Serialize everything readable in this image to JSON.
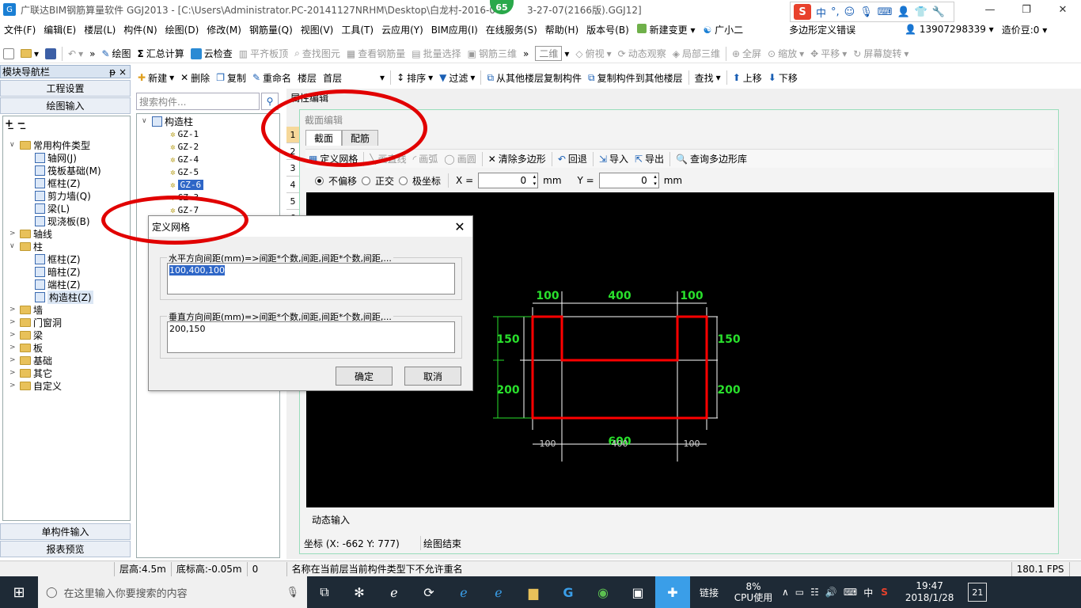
{
  "window": {
    "title": "广联达BIM钢筋算量软件 GGJ2013 - [C:\\Users\\Administrator.PC-20141127NRHM\\Desktop\\白龙村-2016-0",
    "title_tail": "3-27-07(2166版).GGJ12]",
    "badge": "65"
  },
  "ime": {
    "lang": "中",
    "logo": "S"
  },
  "menu": [
    "文件(F)",
    "编辑(E)",
    "楼层(L)",
    "构件(N)",
    "绘图(D)",
    "修改(M)",
    "钢筋量(Q)",
    "视图(V)",
    "工具(T)",
    "云应用(Y)",
    "BIM应用(I)",
    "在线服务(S)",
    "帮助(H)",
    "版本号(B)"
  ],
  "menu_right": {
    "new_change": "新建变更",
    "assistant": "广小二",
    "error": "多边形定义错误",
    "phone": "13907298339",
    "beans": "造价豆:0"
  },
  "toolbar1": {
    "draw": "绘图",
    "sum": "汇总计算",
    "cloud_check": "云检查",
    "flat_top": "平齐板顶",
    "find_elem": "查找图元",
    "view_rebar": "查看钢筋量",
    "batch_select": "批量选择",
    "rebar_3d": "钢筋三维",
    "view_mode": "二维",
    "top_view": "俯视",
    "dynamic_view": "动态观察",
    "local_3d": "局部三维",
    "fullscreen": "全屏",
    "zoom": "缩放",
    "pan": "平移",
    "rotate": "屏幕旋转"
  },
  "nav": {
    "header": "模块导航栏",
    "pin": "ᵽ ×",
    "project_settings": "工程设置",
    "drawing_input": "绘图输入",
    "single_input": "单构件输入",
    "report_preview": "报表预览",
    "tree": [
      {
        "label": "常用构件类型",
        "level": 0,
        "type": "folder",
        "exp": "∨"
      },
      {
        "label": "轴网(J)",
        "level": 1,
        "type": "leaf"
      },
      {
        "label": "筏板基础(M)",
        "level": 1,
        "type": "leaf"
      },
      {
        "label": "框柱(Z)",
        "level": 1,
        "type": "leaf"
      },
      {
        "label": "剪力墙(Q)",
        "level": 1,
        "type": "leaf"
      },
      {
        "label": "梁(L)",
        "level": 1,
        "type": "leaf"
      },
      {
        "label": "现浇板(B)",
        "level": 1,
        "type": "leaf"
      },
      {
        "label": "轴线",
        "level": 0,
        "type": "folder",
        "exp": ">"
      },
      {
        "label": "柱",
        "level": 0,
        "type": "folder",
        "exp": "∨"
      },
      {
        "label": "框柱(Z)",
        "level": 1,
        "type": "leaf"
      },
      {
        "label": "暗柱(Z)",
        "level": 1,
        "type": "leaf"
      },
      {
        "label": "端柱(Z)",
        "level": 1,
        "type": "leaf"
      },
      {
        "label": "构造柱(Z)",
        "level": 1,
        "type": "leaf",
        "selected": true
      },
      {
        "label": "墙",
        "level": 0,
        "type": "folder",
        "exp": ">"
      },
      {
        "label": "门窗洞",
        "level": 0,
        "type": "folder",
        "exp": ">"
      },
      {
        "label": "梁",
        "level": 0,
        "type": "folder",
        "exp": ">"
      },
      {
        "label": "板",
        "level": 0,
        "type": "folder",
        "exp": ">"
      },
      {
        "label": "基础",
        "level": 0,
        "type": "folder",
        "exp": ">"
      },
      {
        "label": "其它",
        "level": 0,
        "type": "folder",
        "exp": ">"
      },
      {
        "label": "自定义",
        "level": 0,
        "type": "folder",
        "exp": ">"
      }
    ]
  },
  "toolbar2": {
    "new": "新建",
    "delete": "删除",
    "copy": "复制",
    "rename": "重命名",
    "floor_label": "楼层",
    "floor_value": "首层",
    "sort": "排序",
    "filter": "过滤",
    "copy_from": "从其他楼层复制构件",
    "copy_to": "复制构件到其他楼层",
    "find": "查找",
    "up": "上移",
    "down": "下移"
  },
  "component_list": {
    "search_placeholder": "搜索构件...",
    "root": "构造柱",
    "items": [
      "GZ-1",
      "GZ-2",
      "GZ-4",
      "GZ-5",
      "GZ-6",
      "GZ-3",
      "GZ-7"
    ],
    "selected": "GZ-6"
  },
  "prop_tab": "属性编辑",
  "row_numbers": [
    "1",
    "2",
    "3",
    "4",
    "5",
    "6"
  ],
  "section_editor": {
    "title": "截面编辑",
    "tabs": [
      "截面",
      "配筋"
    ],
    "tools": {
      "define_grid": "定义网格",
      "polyline": "画直线",
      "arc": "画弧",
      "circle": "画圆",
      "clear": "清除多边形",
      "undo": "回退",
      "import": "导入",
      "export": "导出",
      "query_lib": "查询多边形库"
    },
    "offset": {
      "no_offset": "不偏移",
      "ortho": "正交",
      "polar": "极坐标",
      "x_label": "X =",
      "x_val": "0",
      "y_label": "Y =",
      "y_val": "0",
      "unit": "mm"
    },
    "dims": {
      "top": [
        "100",
        "400",
        "100"
      ],
      "bottom": [
        "100",
        "400",
        "100"
      ],
      "total": "600",
      "left": [
        "150",
        "200"
      ],
      "right": [
        "150",
        "200"
      ]
    },
    "dynamic_input": "动态输入",
    "coord": "坐标 (X: -662 Y: 777)",
    "draw_end": "绘图结束"
  },
  "dialog": {
    "title": "定义网格",
    "h_label": "水平方向间距(mm)=>间距*个数,间距,间距*个数,间距,...",
    "h_value": "100,400,100",
    "v_label": "垂直方向间距(mm)=>间距*个数,间距,间距*个数,间距,...",
    "v_value": "200,150",
    "ok": "确定",
    "cancel": "取消"
  },
  "status": {
    "floor_h": "层高:4.5m",
    "base_h": "底标高:-0.05m",
    "zero": "0",
    "message": "名称在当前层当前构件类型下不允许重名",
    "fps": "180.1 FPS"
  },
  "taskbar": {
    "search_placeholder": "在这里输入你要搜索的内容",
    "net": "链接",
    "cpu_pct": "8%",
    "cpu_label": "CPU使用",
    "lang": "中",
    "time": "19:47",
    "date": "2018/1/28",
    "notif": "21"
  },
  "colors": {
    "accent": "#1a5fb4",
    "annotation_red": "#e10000",
    "section_red": "#ff0000",
    "dim_green": "#29e02c"
  }
}
